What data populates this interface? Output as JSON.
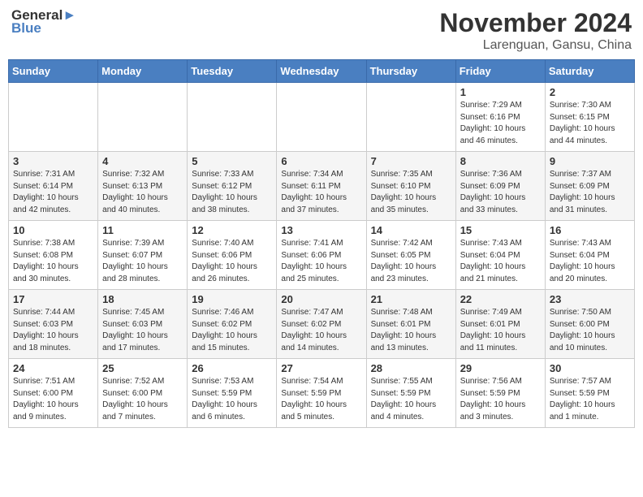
{
  "header": {
    "logo_line1": "General",
    "logo_line2": "Blue",
    "month_title": "November 2024",
    "location": "Larenguan, Gansu, China"
  },
  "days_of_week": [
    "Sunday",
    "Monday",
    "Tuesday",
    "Wednesday",
    "Thursday",
    "Friday",
    "Saturday"
  ],
  "weeks": [
    [
      {
        "day": "",
        "info": ""
      },
      {
        "day": "",
        "info": ""
      },
      {
        "day": "",
        "info": ""
      },
      {
        "day": "",
        "info": ""
      },
      {
        "day": "",
        "info": ""
      },
      {
        "day": "1",
        "info": "Sunrise: 7:29 AM\nSunset: 6:16 PM\nDaylight: 10 hours\nand 46 minutes."
      },
      {
        "day": "2",
        "info": "Sunrise: 7:30 AM\nSunset: 6:15 PM\nDaylight: 10 hours\nand 44 minutes."
      }
    ],
    [
      {
        "day": "3",
        "info": "Sunrise: 7:31 AM\nSunset: 6:14 PM\nDaylight: 10 hours\nand 42 minutes."
      },
      {
        "day": "4",
        "info": "Sunrise: 7:32 AM\nSunset: 6:13 PM\nDaylight: 10 hours\nand 40 minutes."
      },
      {
        "day": "5",
        "info": "Sunrise: 7:33 AM\nSunset: 6:12 PM\nDaylight: 10 hours\nand 38 minutes."
      },
      {
        "day": "6",
        "info": "Sunrise: 7:34 AM\nSunset: 6:11 PM\nDaylight: 10 hours\nand 37 minutes."
      },
      {
        "day": "7",
        "info": "Sunrise: 7:35 AM\nSunset: 6:10 PM\nDaylight: 10 hours\nand 35 minutes."
      },
      {
        "day": "8",
        "info": "Sunrise: 7:36 AM\nSunset: 6:09 PM\nDaylight: 10 hours\nand 33 minutes."
      },
      {
        "day": "9",
        "info": "Sunrise: 7:37 AM\nSunset: 6:09 PM\nDaylight: 10 hours\nand 31 minutes."
      }
    ],
    [
      {
        "day": "10",
        "info": "Sunrise: 7:38 AM\nSunset: 6:08 PM\nDaylight: 10 hours\nand 30 minutes."
      },
      {
        "day": "11",
        "info": "Sunrise: 7:39 AM\nSunset: 6:07 PM\nDaylight: 10 hours\nand 28 minutes."
      },
      {
        "day": "12",
        "info": "Sunrise: 7:40 AM\nSunset: 6:06 PM\nDaylight: 10 hours\nand 26 minutes."
      },
      {
        "day": "13",
        "info": "Sunrise: 7:41 AM\nSunset: 6:06 PM\nDaylight: 10 hours\nand 25 minutes."
      },
      {
        "day": "14",
        "info": "Sunrise: 7:42 AM\nSunset: 6:05 PM\nDaylight: 10 hours\nand 23 minutes."
      },
      {
        "day": "15",
        "info": "Sunrise: 7:43 AM\nSunset: 6:04 PM\nDaylight: 10 hours\nand 21 minutes."
      },
      {
        "day": "16",
        "info": "Sunrise: 7:43 AM\nSunset: 6:04 PM\nDaylight: 10 hours\nand 20 minutes."
      }
    ],
    [
      {
        "day": "17",
        "info": "Sunrise: 7:44 AM\nSunset: 6:03 PM\nDaylight: 10 hours\nand 18 minutes."
      },
      {
        "day": "18",
        "info": "Sunrise: 7:45 AM\nSunset: 6:03 PM\nDaylight: 10 hours\nand 17 minutes."
      },
      {
        "day": "19",
        "info": "Sunrise: 7:46 AM\nSunset: 6:02 PM\nDaylight: 10 hours\nand 15 minutes."
      },
      {
        "day": "20",
        "info": "Sunrise: 7:47 AM\nSunset: 6:02 PM\nDaylight: 10 hours\nand 14 minutes."
      },
      {
        "day": "21",
        "info": "Sunrise: 7:48 AM\nSunset: 6:01 PM\nDaylight: 10 hours\nand 13 minutes."
      },
      {
        "day": "22",
        "info": "Sunrise: 7:49 AM\nSunset: 6:01 PM\nDaylight: 10 hours\nand 11 minutes."
      },
      {
        "day": "23",
        "info": "Sunrise: 7:50 AM\nSunset: 6:00 PM\nDaylight: 10 hours\nand 10 minutes."
      }
    ],
    [
      {
        "day": "24",
        "info": "Sunrise: 7:51 AM\nSunset: 6:00 PM\nDaylight: 10 hours\nand 9 minutes."
      },
      {
        "day": "25",
        "info": "Sunrise: 7:52 AM\nSunset: 6:00 PM\nDaylight: 10 hours\nand 7 minutes."
      },
      {
        "day": "26",
        "info": "Sunrise: 7:53 AM\nSunset: 5:59 PM\nDaylight: 10 hours\nand 6 minutes."
      },
      {
        "day": "27",
        "info": "Sunrise: 7:54 AM\nSunset: 5:59 PM\nDaylight: 10 hours\nand 5 minutes."
      },
      {
        "day": "28",
        "info": "Sunrise: 7:55 AM\nSunset: 5:59 PM\nDaylight: 10 hours\nand 4 minutes."
      },
      {
        "day": "29",
        "info": "Sunrise: 7:56 AM\nSunset: 5:59 PM\nDaylight: 10 hours\nand 3 minutes."
      },
      {
        "day": "30",
        "info": "Sunrise: 7:57 AM\nSunset: 5:59 PM\nDaylight: 10 hours\nand 1 minute."
      }
    ]
  ]
}
